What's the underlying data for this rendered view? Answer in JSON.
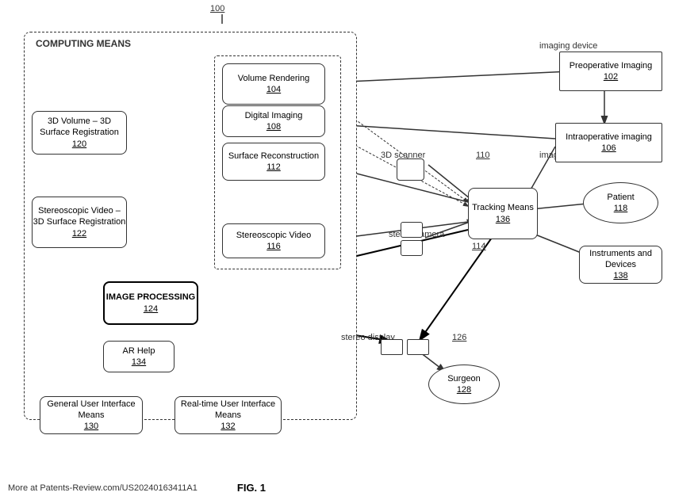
{
  "title": "FIG. 1",
  "footer": {
    "url": "More at Patents-Review.com/US20240163411A1",
    "fig_label": "FIG. 1"
  },
  "boxes": {
    "system_100": {
      "label": "",
      "ref": "100"
    },
    "preoperative_imaging": {
      "label": "Preoperative\nImaging",
      "ref": "102"
    },
    "volume_rendering": {
      "label": "Volume\nRendering",
      "ref": "104"
    },
    "digital_imaging": {
      "label": "Digital Imaging",
      "ref": "108"
    },
    "intraoperative_imaging": {
      "label": "Intraoperative\nimaging",
      "ref": "106"
    },
    "surface_reconstruction": {
      "label": "Surface\nReconstruction",
      "ref": "112"
    },
    "tracking_means": {
      "label": "Tracking\nMeans",
      "ref": "136"
    },
    "stereoscopic_video": {
      "label": "Stereoscopic Video",
      "ref": "116"
    },
    "image_processing": {
      "label": "IMAGE\nPROCESSING",
      "ref": "124"
    },
    "ar_help": {
      "label": "AR Help",
      "ref": "134"
    },
    "vol_3d_surface_reg": {
      "label": "3D Volume – 3D\nSurface Registration",
      "ref": "120"
    },
    "stereo_3d_surface_reg": {
      "label": "Stereoscopic Video\n– 3D Surface\nRegistration",
      "ref": "122"
    },
    "patient": {
      "label": "Patient",
      "ref": "118"
    },
    "instruments": {
      "label": "Instruments\nand Devices",
      "ref": "138"
    },
    "surgeon": {
      "label": "Surgeon",
      "ref": "128"
    },
    "general_ui": {
      "label": "General User\nInterface Means",
      "ref": "130"
    },
    "realtime_ui": {
      "label": "Real-time User\nInterface Means",
      "ref": "132"
    },
    "computing_means": {
      "label": "COMPUTING MEANS",
      "ref": ""
    },
    "scanner_label": {
      "label": "3D scanner",
      "ref": "110"
    },
    "stereo_camera_label": {
      "label": "stereo camera",
      "ref": "114"
    },
    "stereo_display_label": {
      "label": "stereo display",
      "ref": "126"
    },
    "imaging_device_top": {
      "label": "imaging device",
      "ref": ""
    },
    "imaging_device_bottom": {
      "label": "imaging device",
      "ref": ""
    }
  }
}
